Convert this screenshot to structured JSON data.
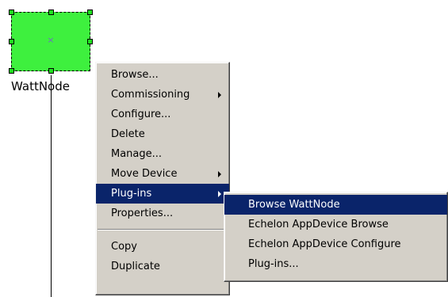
{
  "device": {
    "label": "WattNode",
    "center_glyph": "×",
    "fill_color": "#3ef03e"
  },
  "context_menu": {
    "items": [
      {
        "label": "Browse...",
        "submenu": false
      },
      {
        "label": "Commissioning",
        "submenu": true
      },
      {
        "label": "Configure...",
        "submenu": false
      },
      {
        "label": "Delete",
        "submenu": false
      },
      {
        "label": "Manage...",
        "submenu": false
      },
      {
        "label": "Move Device",
        "submenu": true
      },
      {
        "label": "Plug-ins",
        "submenu": true,
        "active": true
      },
      {
        "label": "Properties...",
        "submenu": false
      },
      {
        "label": "Copy",
        "submenu": false
      },
      {
        "label": "Duplicate",
        "submenu": false
      }
    ]
  },
  "plugins_submenu": {
    "items": [
      {
        "label": "Browse WattNode",
        "active": true
      },
      {
        "label": "Echelon AppDevice Browse"
      },
      {
        "label": "Echelon AppDevice Configure"
      },
      {
        "label": "Plug-ins..."
      }
    ]
  },
  "colors": {
    "menu_background": "#d4d0c8",
    "highlight": "#0a246a",
    "highlight_text": "#ffffff"
  }
}
